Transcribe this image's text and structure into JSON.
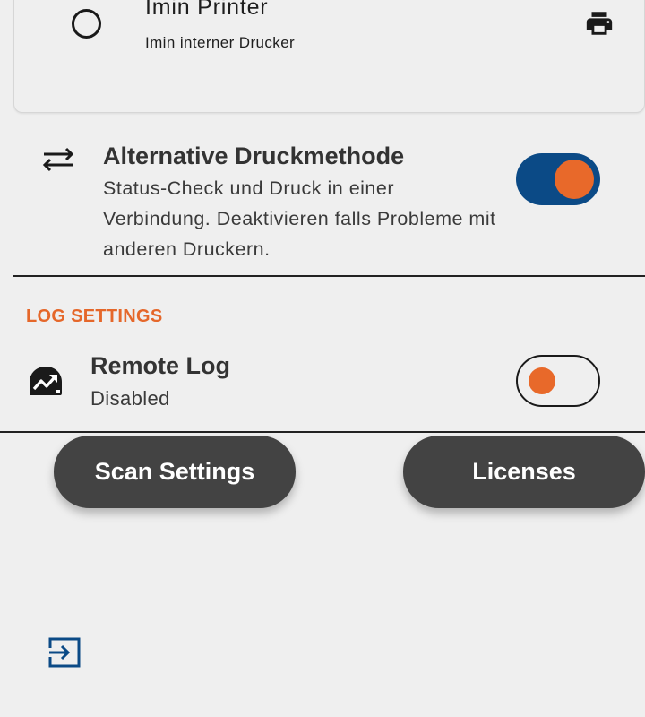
{
  "printer": {
    "title": "Imin Printer",
    "subtitle": "Imin interner Drucker",
    "radio_selected": false,
    "icon": "print-icon"
  },
  "alt_print": {
    "title": "Alternative Druckmethode",
    "description": "Status-Check und Druck in einer Verbindung. Deaktivieren falls Probleme mit anderen Druckern.",
    "enabled": true,
    "icon": "swap-horizontal-icon"
  },
  "log_settings": {
    "header": "LOG SETTINGS",
    "remote_log": {
      "title": "Remote Log",
      "status": "Disabled",
      "enabled": false,
      "icon": "trending-chart-icon"
    }
  },
  "buttons": {
    "scan_settings": "Scan Settings",
    "licenses": "Licenses"
  },
  "footer": {
    "icon": "logout-icon"
  },
  "colors": {
    "accent": "#e8692a",
    "toggle_on_track": "#0b4a86",
    "button_bg": "#434343",
    "section_header": "#e5672a",
    "background": "#efefef"
  }
}
